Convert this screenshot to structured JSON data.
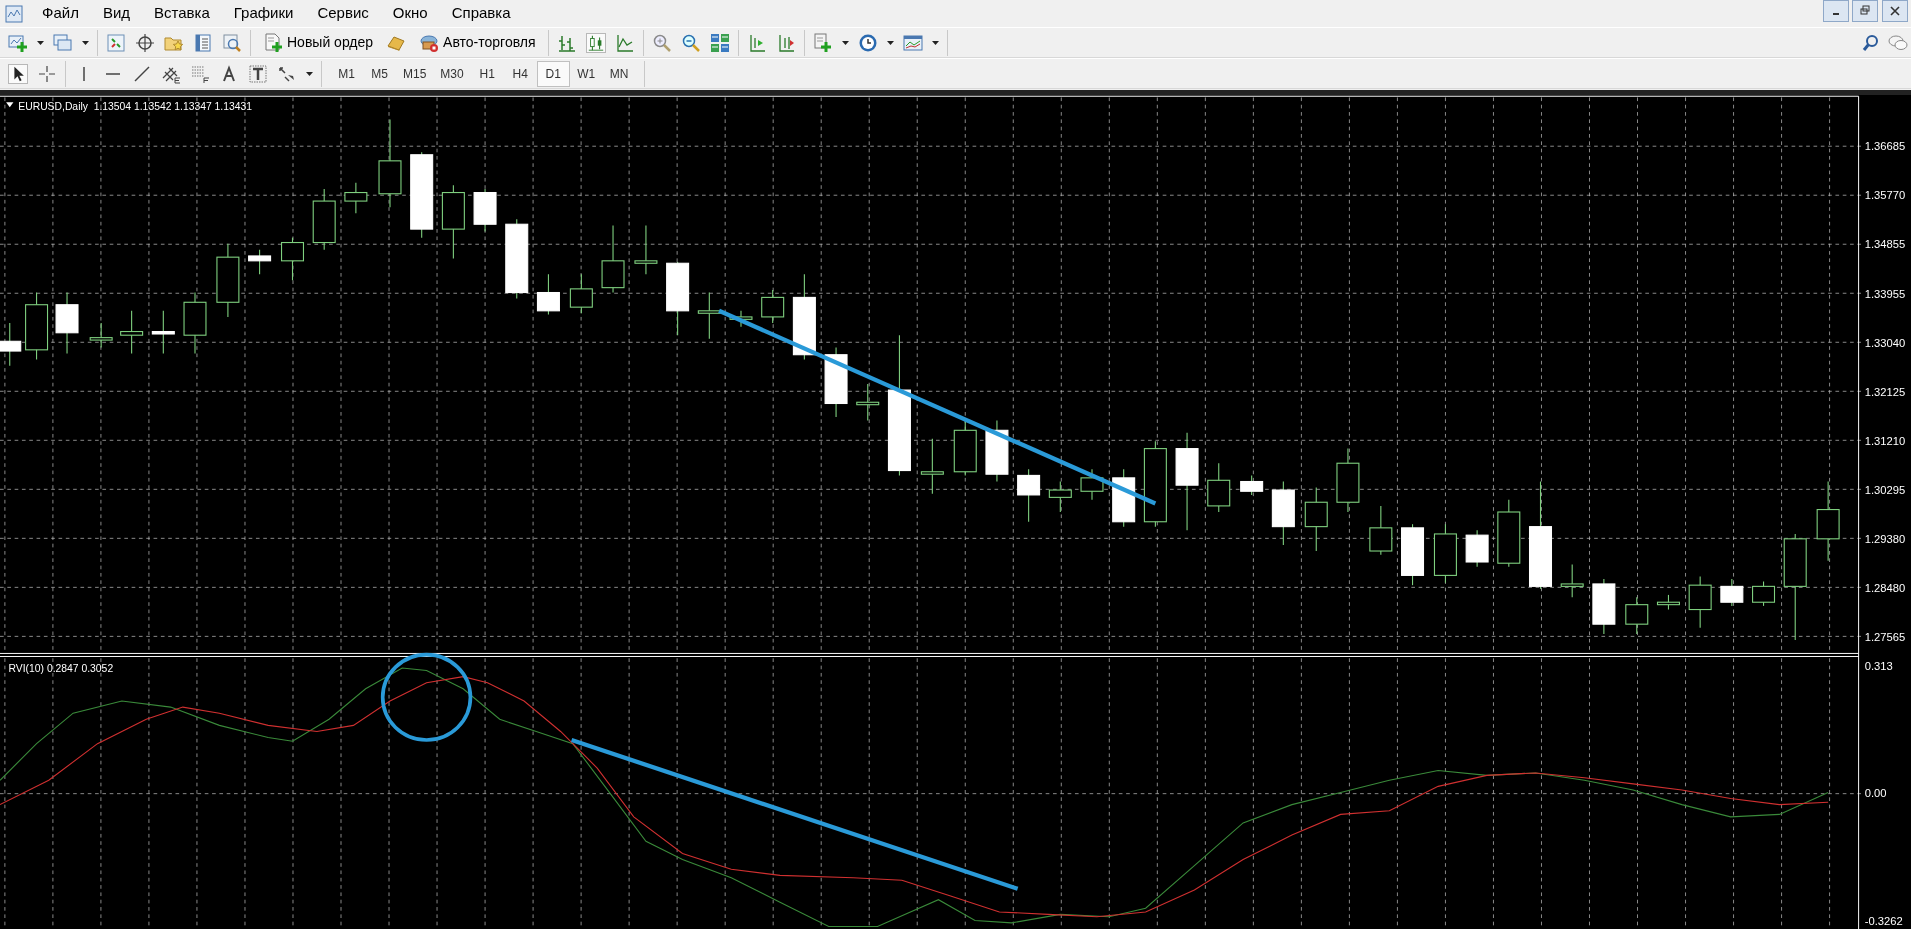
{
  "menu": [
    "Файл",
    "Вид",
    "Вставка",
    "Графики",
    "Сервис",
    "Окно",
    "Справка"
  ],
  "toolbar": {
    "new_order": "Новый ордер",
    "auto_trading": "Авто-торговля",
    "chart_type": [
      {
        "kind": "bars",
        "selected": false
      },
      {
        "kind": "candles",
        "selected": true
      },
      {
        "kind": "line",
        "selected": false
      }
    ]
  },
  "timeframes": [
    {
      "label": "M1",
      "selected": false
    },
    {
      "label": "M5",
      "selected": false
    },
    {
      "label": "M15",
      "selected": false
    },
    {
      "label": "M30",
      "selected": false
    },
    {
      "label": "H1",
      "selected": false
    },
    {
      "label": "H4",
      "selected": false
    },
    {
      "label": "D1",
      "selected": true
    },
    {
      "label": "W1",
      "selected": false
    },
    {
      "label": "MN",
      "selected": false
    }
  ],
  "chart": {
    "header": "EURUSD,Daily  1.13504 1.13542 1.13347 1.13431",
    "price_axis": [
      "1.36685",
      "1.35770",
      "1.34855",
      "1.33955",
      "1.33040",
      "1.32125",
      "1.31210",
      "1.30295",
      "1.29380",
      "1.28480",
      "1.27565"
    ],
    "indicator": {
      "label": "RVI(10) 0.2847 0.3052",
      "axis": [
        "0.313",
        "0.00",
        "-0.3262"
      ]
    }
  }
}
